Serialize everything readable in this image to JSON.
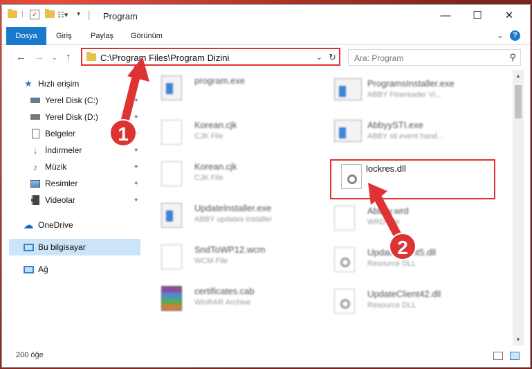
{
  "window": {
    "title": "Program",
    "minimize": "—",
    "maximize": "☐",
    "close": "✕"
  },
  "ribbon": {
    "tabs": [
      "Dosya",
      "Giriş",
      "Paylaş",
      "Görünüm"
    ],
    "help": "?"
  },
  "address": {
    "path": "C:\\Program Files\\Program Dizini",
    "search_placeholder": "Ara: Program"
  },
  "sidebar": {
    "items": [
      {
        "label": "Hızlı erişim",
        "icon": "star-icon"
      },
      {
        "label": "Yerel Disk (C:)",
        "icon": "drive-icon"
      },
      {
        "label": "Yerel Disk (D:)",
        "icon": "drive-icon"
      },
      {
        "label": "Belgeler",
        "icon": "documents-icon"
      },
      {
        "label": "İndirmeler",
        "icon": "download-icon"
      },
      {
        "label": "Müzik",
        "icon": "music-icon"
      },
      {
        "label": "Resimler",
        "icon": "pictures-icon"
      },
      {
        "label": "Videolar",
        "icon": "videos-icon"
      },
      {
        "label": "OneDrive",
        "icon": "cloud-icon"
      },
      {
        "label": "Bu bilgisayar",
        "icon": "computer-icon"
      },
      {
        "label": "Ağ",
        "icon": "network-icon"
      }
    ]
  },
  "files": {
    "col1": [
      {
        "name": "program.exe",
        "desc": ""
      },
      {
        "name": "Korean.cjk",
        "desc": "CJK File"
      },
      {
        "name": "Korean.cjk",
        "desc": "CJK File"
      },
      {
        "name": "UpdateInstaller.exe",
        "desc": "ABBY updates installer"
      },
      {
        "name": "SndToWP12.wcm",
        "desc": "WCM File"
      },
      {
        "name": "certificates.cab",
        "desc": "WinRAR Archive"
      }
    ],
    "col2": [
      {
        "name": "ProgramsInstaller.exe",
        "desc": "ABBY Finereader Vi..."
      },
      {
        "name": "AbbyySTI.exe",
        "desc": "ABBY sti event hand..."
      },
      {
        "name": "",
        "desc": ""
      },
      {
        "name": "Abbyy.wrd",
        "desc": "WRD File"
      },
      {
        "name": "UpdateClient5.dll",
        "desc": "Resource DLL"
      },
      {
        "name": "UpdateClient42.dll",
        "desc": "Resource DLL"
      }
    ],
    "highlighted": "lockres.dll"
  },
  "callouts": {
    "one": "1",
    "two": "2"
  },
  "status": {
    "count": "200 öğe"
  },
  "colors": {
    "accent": "#1979ca",
    "highlight": "#e03030"
  }
}
